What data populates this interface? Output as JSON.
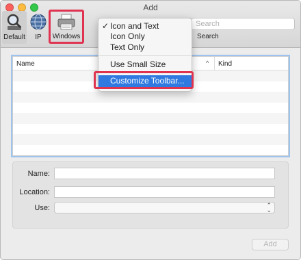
{
  "window": {
    "title": "Add"
  },
  "toolbar": {
    "items": [
      {
        "label": "Default",
        "icon": "magnifier-icon"
      },
      {
        "label": "IP",
        "icon": "globe-icon"
      },
      {
        "label": "Windows",
        "icon": "printer-icon"
      }
    ],
    "search_placeholder": "Search",
    "search_label": "Search"
  },
  "context_menu": {
    "items": [
      {
        "label": "Icon and Text",
        "checked": true
      },
      {
        "label": "Icon Only",
        "checked": false
      },
      {
        "label": "Text Only",
        "checked": false
      },
      {
        "label": "Use Small Size",
        "checked": false
      },
      {
        "label": "Customize Toolbar...",
        "checked": false,
        "highlighted": true
      }
    ],
    "check_glyph": "✓"
  },
  "table": {
    "columns": [
      {
        "label": "Name"
      },
      {
        "label": "^"
      },
      {
        "label": "Kind"
      }
    ],
    "row_count": 8
  },
  "form": {
    "name_label": "Name:",
    "location_label": "Location:",
    "use_label": "Use:",
    "name_value": "",
    "location_value": "",
    "use_value": "",
    "use_arrows": "⌃⌄"
  },
  "buttons": {
    "add_label": "Add"
  },
  "colors": {
    "highlight_blue": "#2f79e0",
    "annotation_red": "#e0334f",
    "focus_ring": "#9ec3ee"
  }
}
